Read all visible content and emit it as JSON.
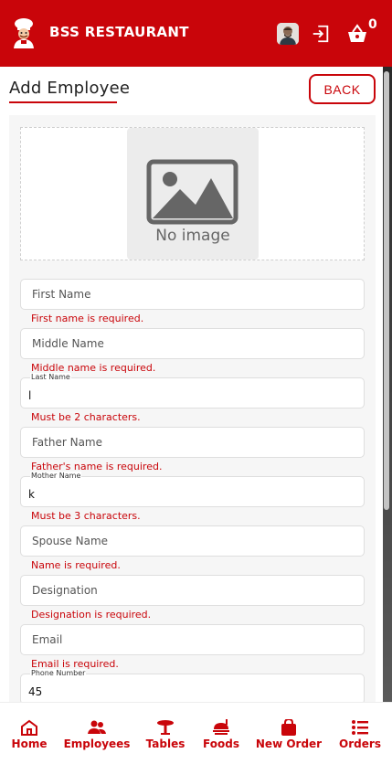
{
  "header": {
    "brand_title": "BSS RESTAURANT",
    "cart_count": "0",
    "logo_icon": "chef-icon",
    "user_icon": "user-avatar",
    "logout_icon": "logout-icon",
    "cart_icon": "basket-icon"
  },
  "page": {
    "title": "Add Employee",
    "back_label": "BACK"
  },
  "image_upload": {
    "placeholder_text": "No image",
    "icon": "image-placeholder-icon"
  },
  "form": {
    "fields": [
      {
        "label": "First Name",
        "value": "",
        "error": "First name is required."
      },
      {
        "label": "Middle Name",
        "value": "",
        "error": "Middle name is required."
      },
      {
        "label": "Last Name",
        "value": "l",
        "error": "Must be 2 characters."
      },
      {
        "label": "Father Name",
        "value": "",
        "error": "Father's name is required."
      },
      {
        "label": "Mother Name",
        "value": "k",
        "error": "Must be 3 characters."
      },
      {
        "label": "Spouse Name",
        "value": "",
        "error": "Name is required."
      },
      {
        "label": "Designation",
        "value": "",
        "error": "Designation is required."
      },
      {
        "label": "Email",
        "value": "",
        "error": "Email is required."
      },
      {
        "label": "Phone Number",
        "value": "45",
        "error": ""
      }
    ]
  },
  "bottom_nav": {
    "items": [
      {
        "label": "Home",
        "icon": "home-icon"
      },
      {
        "label": "Employees",
        "icon": "people-icon"
      },
      {
        "label": "Tables",
        "icon": "table-icon"
      },
      {
        "label": "Foods",
        "icon": "food-icon"
      },
      {
        "label": "New Order",
        "icon": "shopping-bag-icon"
      },
      {
        "label": "Orders",
        "icon": "list-icon"
      }
    ]
  },
  "colors": {
    "primary": "#c9050a",
    "background": "#ffffff",
    "panel": "#f6f6f6"
  }
}
